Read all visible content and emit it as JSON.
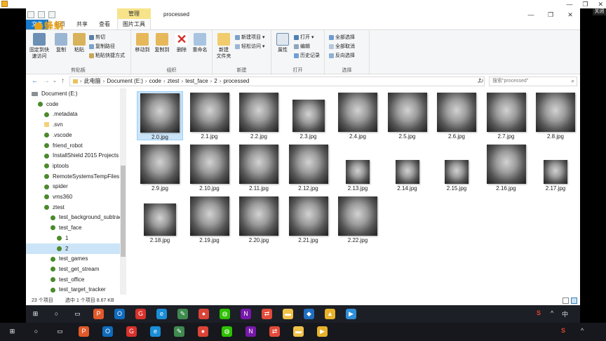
{
  "outer": {
    "close_tag": "关闭",
    "controls": [
      "—",
      "❐",
      "✕"
    ]
  },
  "window": {
    "title": "processed",
    "context_tab_top": "管理",
    "context_tab_bottom": "图片工具",
    "tabs": [
      "文件",
      "主页",
      "共享",
      "查看"
    ],
    "overlay_text": "蜂蜗"
  },
  "ribbon": {
    "clipboard": {
      "label": "剪贴板",
      "pin": "固定到快\n速访问",
      "copy": "复制",
      "paste": "粘贴",
      "cut": "剪切",
      "copy_path": "复制路径",
      "paste_shortcut": "粘贴快捷方式"
    },
    "organize": {
      "label": "组织",
      "move_to": "移动到",
      "copy_to": "复制到",
      "delete": "删除",
      "rename": "重命名"
    },
    "new": {
      "label": "新建",
      "new_folder": "新建\n文件夹",
      "new_item": "新建项目 ▾",
      "easy_access": "轻松访问 ▾"
    },
    "open": {
      "label": "打开",
      "properties": "属性",
      "open": "打开 ▾",
      "edit": "编辑",
      "history": "历史记录"
    },
    "select": {
      "label": "选择",
      "select_all": "全部选择",
      "select_none": "全部取消",
      "invert": "反向选择"
    }
  },
  "address": {
    "crumbs": [
      "此电脑",
      "Document (E:)",
      "code",
      "ztest",
      "test_face",
      "2",
      "processed"
    ],
    "search_placeholder": "搜索\"processed\""
  },
  "tree": [
    {
      "label": "Document (E:)",
      "icon": "drive",
      "indent": 0
    },
    {
      "label": "code",
      "icon": "svn",
      "indent": 1
    },
    {
      "label": ".metadata",
      "icon": "svn",
      "indent": 2
    },
    {
      "label": ".svn",
      "icon": "folder",
      "indent": 2
    },
    {
      "label": ".vscode",
      "icon": "svn",
      "indent": 2
    },
    {
      "label": "friend_robot",
      "icon": "svn",
      "indent": 2
    },
    {
      "label": "InstallShield 2015 Projects",
      "icon": "svn",
      "indent": 2
    },
    {
      "label": "iptools",
      "icon": "svn",
      "indent": 2
    },
    {
      "label": "RemoteSystemsTempFiles",
      "icon": "svn",
      "indent": 2
    },
    {
      "label": "spider",
      "icon": "svn",
      "indent": 2
    },
    {
      "label": "vms360",
      "icon": "svn",
      "indent": 2
    },
    {
      "label": "ztest",
      "icon": "svn",
      "indent": 2
    },
    {
      "label": "test_background_subtrac",
      "icon": "svn",
      "indent": 3
    },
    {
      "label": "test_face",
      "icon": "svn",
      "indent": 3
    },
    {
      "label": "1",
      "icon": "svn",
      "indent": 4
    },
    {
      "label": "2",
      "icon": "svn",
      "indent": 4,
      "selected": true
    },
    {
      "label": "test_games",
      "icon": "svn",
      "indent": 3
    },
    {
      "label": "test_get_stream",
      "icon": "svn",
      "indent": 3
    },
    {
      "label": "test_office",
      "icon": "svn",
      "indent": 3
    },
    {
      "label": "test_target_tracker",
      "icon": "svn",
      "indent": 3
    }
  ],
  "files": [
    {
      "name": "2.0.jpg",
      "size": "l",
      "selected": true
    },
    {
      "name": "2.1.jpg",
      "size": "l"
    },
    {
      "name": "2.2.jpg",
      "size": "l"
    },
    {
      "name": "2.3.jpg",
      "size": "m"
    },
    {
      "name": "2.4.jpg",
      "size": "l"
    },
    {
      "name": "2.5.jpg",
      "size": "l"
    },
    {
      "name": "2.6.jpg",
      "size": "l"
    },
    {
      "name": "2.7.jpg",
      "size": "l"
    },
    {
      "name": "2.8.jpg",
      "size": "l"
    },
    {
      "name": "2.9.jpg",
      "size": "l"
    },
    {
      "name": "2.10.jpg",
      "size": "l"
    },
    {
      "name": "2.11.jpg",
      "size": "l"
    },
    {
      "name": "2.12.jpg",
      "size": "l"
    },
    {
      "name": "2.13.jpg",
      "size": "s"
    },
    {
      "name": "2.14.jpg",
      "size": "s"
    },
    {
      "name": "2.15.jpg",
      "size": "s"
    },
    {
      "name": "2.16.jpg",
      "size": "l"
    },
    {
      "name": "2.17.jpg",
      "size": "s"
    },
    {
      "name": "2.18.jpg",
      "size": "m"
    },
    {
      "name": "2.19.jpg",
      "size": "l"
    },
    {
      "name": "2.20.jpg",
      "size": "l"
    },
    {
      "name": "2.21.jpg",
      "size": "l"
    },
    {
      "name": "2.22.jpg",
      "size": "l"
    }
  ],
  "status": {
    "count": "23 个项目",
    "selected": "选中 1 个项目 8.67 KB"
  },
  "taskbar_apps": [
    "start",
    "search",
    "task-view",
    "app-red",
    "outlook",
    "app-g",
    "ie",
    "notepad",
    "chrome",
    "wechat",
    "onenote",
    "remote",
    "explorer",
    "vscode",
    "app-yellow",
    "app-video"
  ],
  "taskbar2_apps": [
    "start",
    "search",
    "task-view",
    "app-red",
    "outlook",
    "app-g",
    "ie",
    "notepad",
    "chrome",
    "wechat",
    "onenote",
    "remote",
    "explorer",
    "video"
  ],
  "tray": {
    "chevron": "^",
    "ime": "中",
    "ime_label": "S"
  },
  "colors": {
    "accent": "#1979ca",
    "selection": "#cce4f7",
    "context": "#f7e38a"
  }
}
